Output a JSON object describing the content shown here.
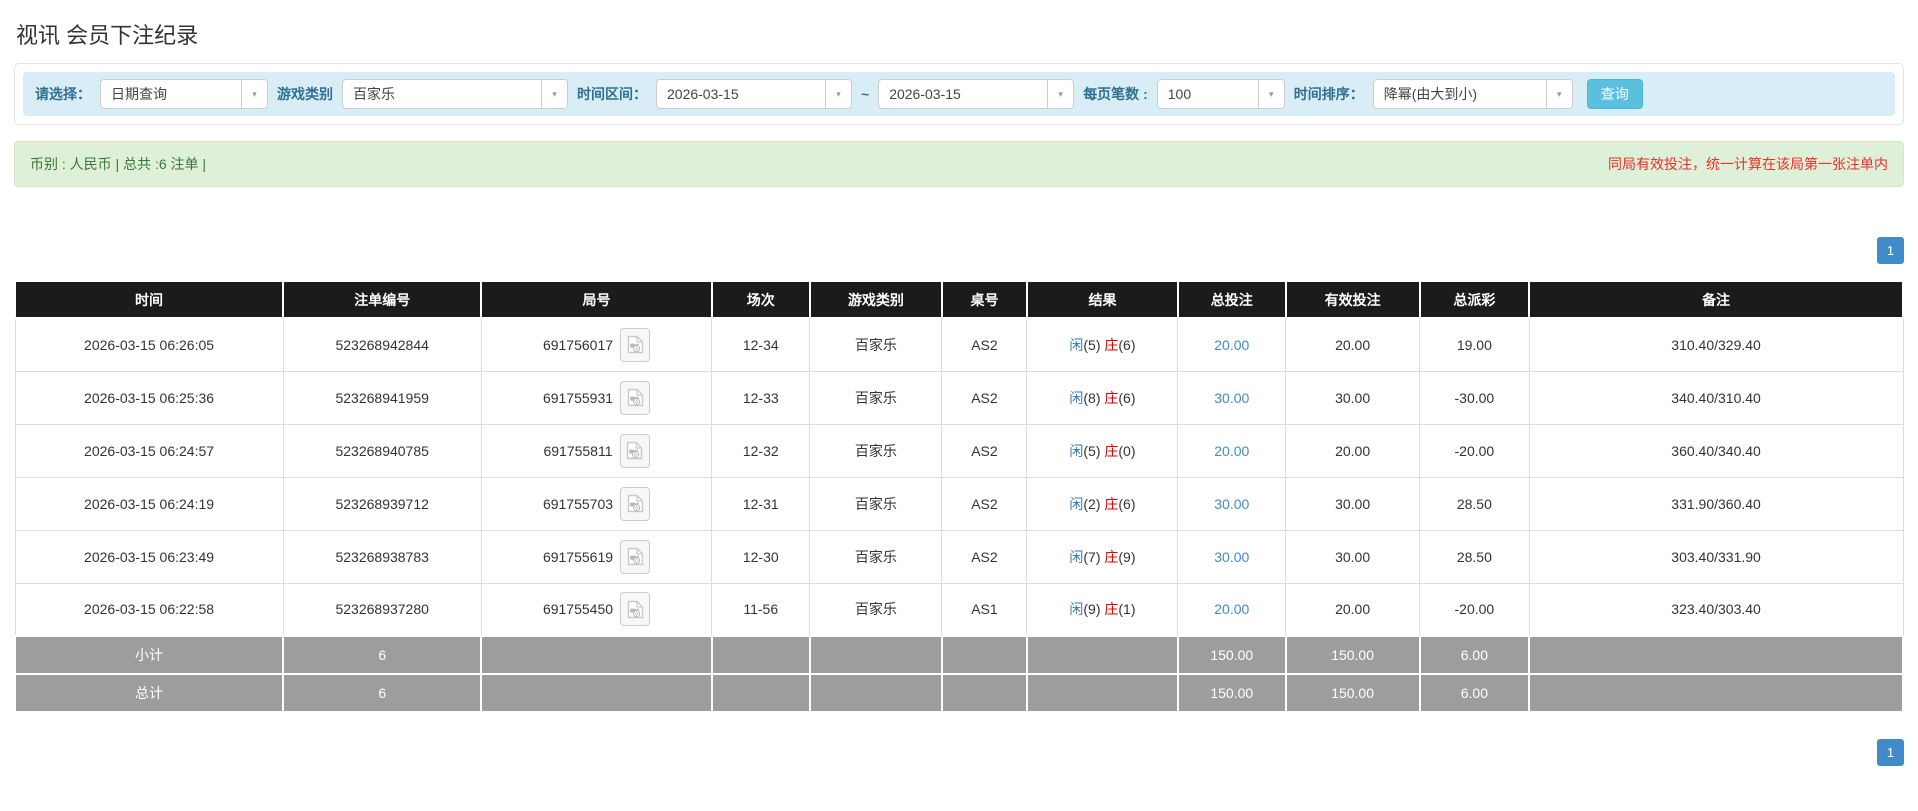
{
  "page": {
    "title": "视讯 会员下注纪录"
  },
  "icons": {
    "chevron_down": "▾"
  },
  "colors": {
    "accent_blue": "#428bca",
    "info_bar_bg": "#d9edf7",
    "success_bar_bg": "#dff0d8",
    "success_text": "#3c763d",
    "warning_red": "#e8312a",
    "negative_red": "#e60000",
    "header_black": "#1b1b1b",
    "footer_gray": "#9d9d9d",
    "search_btn": "#5bc0de"
  },
  "filters": {
    "query_type_label": "请选择：",
    "query_type_value": "日期查询",
    "game_type_label": "游戏类别",
    "game_type_value": "百家乐",
    "time_range_label": "时间区间：",
    "date_from": "2026-03-15",
    "range_separator": "~",
    "date_to": "2026-03-15",
    "page_size_label": "每页笔数 :",
    "page_size_value": "100",
    "time_sort_label": "时间排序：",
    "time_sort_value": "降幂(由大到小)",
    "search_button": "查询"
  },
  "summary": {
    "left_text": "币别 : 人民币 | 总共 :6 注单 |",
    "right_text": "同局有效投注，统一计算在该局第一张注单内"
  },
  "pagination": {
    "page": "1"
  },
  "table": {
    "headers": [
      "时间",
      "注单编号",
      "局号",
      "场次",
      "游戏类别",
      "桌号",
      "结果",
      "总投注",
      "有效投注",
      "总派彩",
      "备注"
    ],
    "result_player_label": "闲",
    "result_banker_label": "庄",
    "rows": [
      {
        "time": "2026-03-15 06:26:05",
        "bet_id": "523268942844",
        "round_id": "691756017",
        "session": "12-34",
        "game": "百家乐",
        "table_no": "AS2",
        "player_score": "(5)",
        "banker_score": "(6)",
        "total_bet": "20.00",
        "valid_bet": "20.00",
        "payout": "19.00",
        "remark": "310.40/329.40"
      },
      {
        "time": "2026-03-15 06:25:36",
        "bet_id": "523268941959",
        "round_id": "691755931",
        "session": "12-33",
        "game": "百家乐",
        "table_no": "AS2",
        "player_score": "(8)",
        "banker_score": "(6)",
        "total_bet": "30.00",
        "valid_bet": "30.00",
        "payout": "-30.00",
        "remark": "340.40/310.40"
      },
      {
        "time": "2026-03-15 06:24:57",
        "bet_id": "523268940785",
        "round_id": "691755811",
        "session": "12-32",
        "game": "百家乐",
        "table_no": "AS2",
        "player_score": "(5)",
        "banker_score": "(0)",
        "total_bet": "20.00",
        "valid_bet": "20.00",
        "payout": "-20.00",
        "remark": "360.40/340.40"
      },
      {
        "time": "2026-03-15 06:24:19",
        "bet_id": "523268939712",
        "round_id": "691755703",
        "session": "12-31",
        "game": "百家乐",
        "table_no": "AS2",
        "player_score": "(2)",
        "banker_score": "(6)",
        "total_bet": "30.00",
        "valid_bet": "30.00",
        "payout": "28.50",
        "remark": "331.90/360.40"
      },
      {
        "time": "2026-03-15 06:23:49",
        "bet_id": "523268938783",
        "round_id": "691755619",
        "session": "12-30",
        "game": "百家乐",
        "table_no": "AS2",
        "player_score": "(7)",
        "banker_score": "(9)",
        "total_bet": "30.00",
        "valid_bet": "30.00",
        "payout": "28.50",
        "remark": "303.40/331.90"
      },
      {
        "time": "2026-03-15 06:22:58",
        "bet_id": "523268937280",
        "round_id": "691755450",
        "session": "11-56",
        "game": "百家乐",
        "table_no": "AS1",
        "player_score": "(9)",
        "banker_score": "(1)",
        "total_bet": "20.00",
        "valid_bet": "20.00",
        "payout": "-20.00",
        "remark": "323.40/303.40"
      }
    ],
    "subtotal": {
      "label": "小计",
      "count": "6",
      "total_bet": "150.00",
      "valid_bet": "150.00",
      "payout": "6.00"
    },
    "total": {
      "label": "总计",
      "count": "6",
      "total_bet": "150.00",
      "valid_bet": "150.00",
      "payout": "6.00"
    }
  }
}
